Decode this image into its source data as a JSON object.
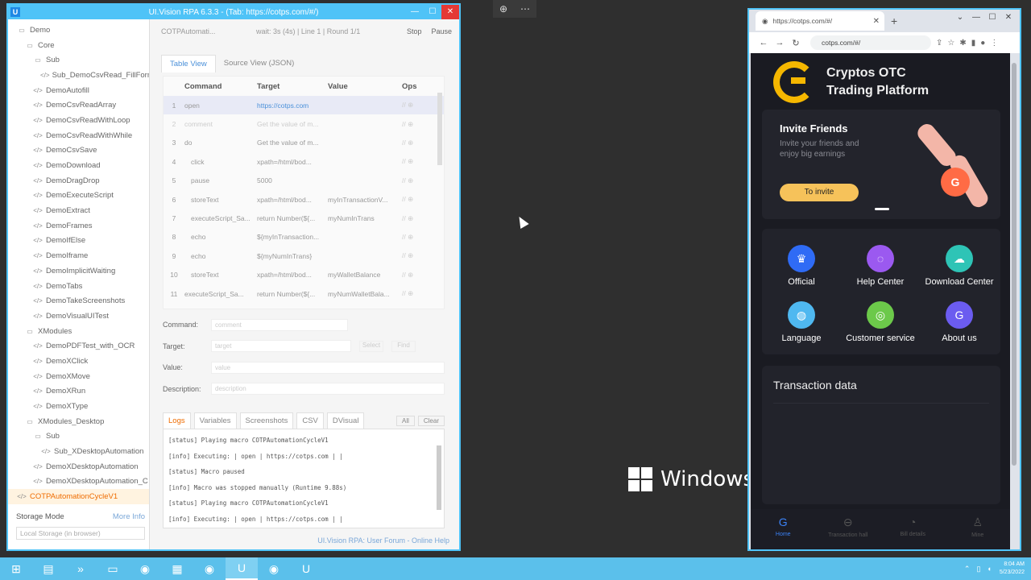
{
  "desktop": {
    "watermark": "Windows",
    "toolbar_icons": [
      "zoom-icon",
      "more-icon"
    ]
  },
  "uivision": {
    "title": "UI.Vision RPA 6.3.3 - (Tab: https://cotps.com/#/)",
    "tree": [
      {
        "label": "Demo",
        "level": 0,
        "type": "folder"
      },
      {
        "label": "Core",
        "level": 1,
        "type": "folder"
      },
      {
        "label": "Sub",
        "level": 2,
        "type": "folder"
      },
      {
        "label": "Sub_DemoCsvRead_FillForm",
        "level": 3,
        "type": "macro"
      },
      {
        "label": "DemoAutofill",
        "level": 2,
        "type": "macro"
      },
      {
        "label": "DemoCsvReadArray",
        "level": 2,
        "type": "macro"
      },
      {
        "label": "DemoCsvReadWithLoop",
        "level": 2,
        "type": "macro"
      },
      {
        "label": "DemoCsvReadWithWhile",
        "level": 2,
        "type": "macro"
      },
      {
        "label": "DemoCsvSave",
        "level": 2,
        "type": "macro"
      },
      {
        "label": "DemoDownload",
        "level": 2,
        "type": "macro"
      },
      {
        "label": "DemoDragDrop",
        "level": 2,
        "type": "macro"
      },
      {
        "label": "DemoExecuteScript",
        "level": 2,
        "type": "macro"
      },
      {
        "label": "DemoExtract",
        "level": 2,
        "type": "macro"
      },
      {
        "label": "DemoFrames",
        "level": 2,
        "type": "macro"
      },
      {
        "label": "DemoIfElse",
        "level": 2,
        "type": "macro"
      },
      {
        "label": "DemoIframe",
        "level": 2,
        "type": "macro"
      },
      {
        "label": "DemoImplicitWaiting",
        "level": 2,
        "type": "macro"
      },
      {
        "label": "DemoTabs",
        "level": 2,
        "type": "macro"
      },
      {
        "label": "DemoTakeScreenshots",
        "level": 2,
        "type": "macro"
      },
      {
        "label": "DemoVisualUITest",
        "level": 2,
        "type": "macro"
      },
      {
        "label": "XModules",
        "level": 1,
        "type": "folder"
      },
      {
        "label": "DemoPDFTest_with_OCR",
        "level": 2,
        "type": "macro"
      },
      {
        "label": "DemoXClick",
        "level": 2,
        "type": "macro"
      },
      {
        "label": "DemoXMove",
        "level": 2,
        "type": "macro"
      },
      {
        "label": "DemoXRun",
        "level": 2,
        "type": "macro"
      },
      {
        "label": "DemoXType",
        "level": 2,
        "type": "macro"
      },
      {
        "label": "XModules_Desktop",
        "level": 1,
        "type": "folder"
      },
      {
        "label": "Sub",
        "level": 2,
        "type": "folder"
      },
      {
        "label": "Sub_XDesktopAutomation",
        "level": 3,
        "type": "macro"
      },
      {
        "label": "DemoXDesktopAutomation",
        "level": 2,
        "type": "macro"
      },
      {
        "label": "DemoXDesktopAutomation_C",
        "level": 2,
        "type": "macro"
      },
      {
        "label": "COTPAutomationCycleV1",
        "level": 0,
        "type": "macro",
        "active": true
      }
    ],
    "storage_mode_label": "Storage Mode",
    "more_info": "More Info",
    "storage_value": "Local Storage (in browser)",
    "macro_name": "COTPAutomati...",
    "macro_status": "wait: 3s (4s) | Line 1 | Round 1/1",
    "stop_label": "Stop",
    "pause_label": "Pause",
    "tab_table": "Table View",
    "tab_source": "Source View (JSON)",
    "columns": {
      "command": "Command",
      "target": "Target",
      "value": "Value",
      "ops": "Ops"
    },
    "rows": [
      {
        "idx": "1",
        "cmd": "open",
        "target": "https://cotps.com",
        "value": ""
      },
      {
        "idx": "2",
        "cmd": "comment",
        "target": "Get the value of m...",
        "value": ""
      },
      {
        "idx": "3",
        "cmd": "do",
        "target": "Get the value of m...",
        "value": ""
      },
      {
        "idx": "4",
        "cmd": "click",
        "target": "xpath=/html/bod...",
        "value": ""
      },
      {
        "idx": "5",
        "cmd": "pause",
        "target": "5000",
        "value": ""
      },
      {
        "idx": "6",
        "cmd": "storeText",
        "target": "xpath=/html/bod...",
        "value": "myInTransactionV..."
      },
      {
        "idx": "7",
        "cmd": "executeScript_Sa...",
        "target": "return Number(${...",
        "value": "myNumInTrans"
      },
      {
        "idx": "8",
        "cmd": "echo",
        "target": "${myInTransaction...",
        "value": ""
      },
      {
        "idx": "9",
        "cmd": "echo",
        "target": "${myNumInTrans}",
        "value": ""
      },
      {
        "idx": "10",
        "cmd": "storeText",
        "target": "xpath=/html/bod...",
        "value": "myWalletBalance"
      },
      {
        "idx": "11",
        "cmd": "executeScript_Sa...",
        "target": "return Number(${...",
        "value": "myNumWalletBala..."
      }
    ],
    "form": {
      "command_label": "Command:",
      "command_placeholder": "comment",
      "target_label": "Target:",
      "target_placeholder": "target",
      "select_label": "Select",
      "find_label": "Find",
      "value_label": "Value:",
      "value_placeholder": "value",
      "description_label": "Description:",
      "description_placeholder": "description"
    },
    "log_tabs": [
      "Logs",
      "Variables",
      "Screenshots",
      "CSV",
      "DVisual"
    ],
    "log_filter": "All",
    "log_clear": "Clear",
    "logs": [
      "[status]  Playing macro COTPAutomationCycleV1",
      "[info]  Executing:  | open | https://cotps.com |  |",
      "[status]  Macro paused",
      "[info]  Macro was stopped manually (Runtime 9.88s)",
      "[status]  Playing macro COTPAutomationCycleV1",
      "[info]  Executing:  | open | https://cotps.com |  |"
    ],
    "footer": "UI.Vision RPA: User Forum - Online Help"
  },
  "browser": {
    "tab_title": "https://cotps.com/#/",
    "url": "cotps.com/#/",
    "brand_line1": "Cryptos  OTC",
    "brand_line2": "Trading  Platform",
    "invite_title": "Invite Friends",
    "invite_sub": "Invite your friends and enjoy big earnings",
    "invite_button": "To invite",
    "grid": [
      {
        "label": "Official",
        "color": "#2f6bf5",
        "icon": "crown-icon",
        "glyph": "♛"
      },
      {
        "label": "Help Center",
        "color": "#9b59f0",
        "icon": "chat-icon",
        "glyph": "◌"
      },
      {
        "label": "Download Center",
        "color": "#2ec4b6",
        "icon": "cloud-icon",
        "glyph": "☁"
      },
      {
        "label": "Language",
        "color": "#4fb8f0",
        "icon": "globe-icon",
        "glyph": "◍"
      },
      {
        "label": "Customer service",
        "color": "#6cc94a",
        "icon": "headset-icon",
        "glyph": "◎"
      },
      {
        "label": "About us",
        "color": "#6b5cf0",
        "icon": "info-icon",
        "glyph": "G"
      }
    ],
    "transaction_title": "Transaction data",
    "bottom_nav": [
      {
        "label": "Home",
        "icon": "home-icon",
        "glyph": "G",
        "active": true
      },
      {
        "label": "Transaction hall",
        "icon": "transaction-icon",
        "glyph": "⊖",
        "active": false
      },
      {
        "label": "Bill details",
        "icon": "bill-icon",
        "glyph": "◔",
        "active": false
      },
      {
        "label": "Mine",
        "icon": "user-icon",
        "glyph": "♙",
        "active": false
      }
    ]
  },
  "taskbar": {
    "items": [
      "start-icon",
      "file-explorer-icon",
      "powershell-icon",
      "folder-icon",
      "chrome-icon",
      "sheets-icon",
      "chrome-icon-2",
      "uivision-icon",
      "chrome-icon-3",
      "uivision-icon-2"
    ],
    "time": "8:04 AM",
    "date": "5/23/2022"
  }
}
